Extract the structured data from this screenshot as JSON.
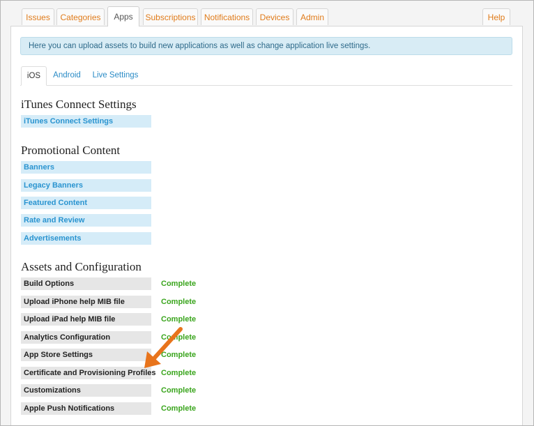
{
  "tabs": [
    "Issues",
    "Categories",
    "Apps",
    "Subscriptions",
    "Notifications",
    "Devices",
    "Admin"
  ],
  "help_tab": "Help",
  "alert_text": "Here you can upload assets to build new applications as well as change application live settings.",
  "subtabs": [
    "iOS",
    "Android",
    "Live Settings"
  ],
  "sections": {
    "itunes": {
      "heading": "iTunes Connect Settings",
      "items": [
        "iTunes Connect Settings"
      ]
    },
    "promo": {
      "heading": "Promotional Content",
      "items": [
        "Banners",
        "Legacy Banners",
        "Featured Content",
        "Rate and Review",
        "Advertisements"
      ]
    },
    "assets": {
      "heading": "Assets and Configuration",
      "items": [
        {
          "label": "Build Options",
          "status": "Complete"
        },
        {
          "label": "Upload iPhone help MIB file",
          "status": "Complete"
        },
        {
          "label": "Upload iPad help MIB file",
          "status": "Complete"
        },
        {
          "label": "Analytics Configuration",
          "status": "Complete"
        },
        {
          "label": "App Store Settings",
          "status": "Complete"
        },
        {
          "label": "Certificate and Provisioning Profiles",
          "status": "Complete"
        },
        {
          "label": "Customizations",
          "status": "Complete"
        },
        {
          "label": "Apple Push Notifications",
          "status": "Complete"
        }
      ]
    }
  },
  "colors": {
    "tab_text": "#e07b1a",
    "link": "#2a94d0",
    "link_bg": "#d5ecf8",
    "complete": "#3aa51d",
    "annotation_arrow": "#e8741c"
  }
}
